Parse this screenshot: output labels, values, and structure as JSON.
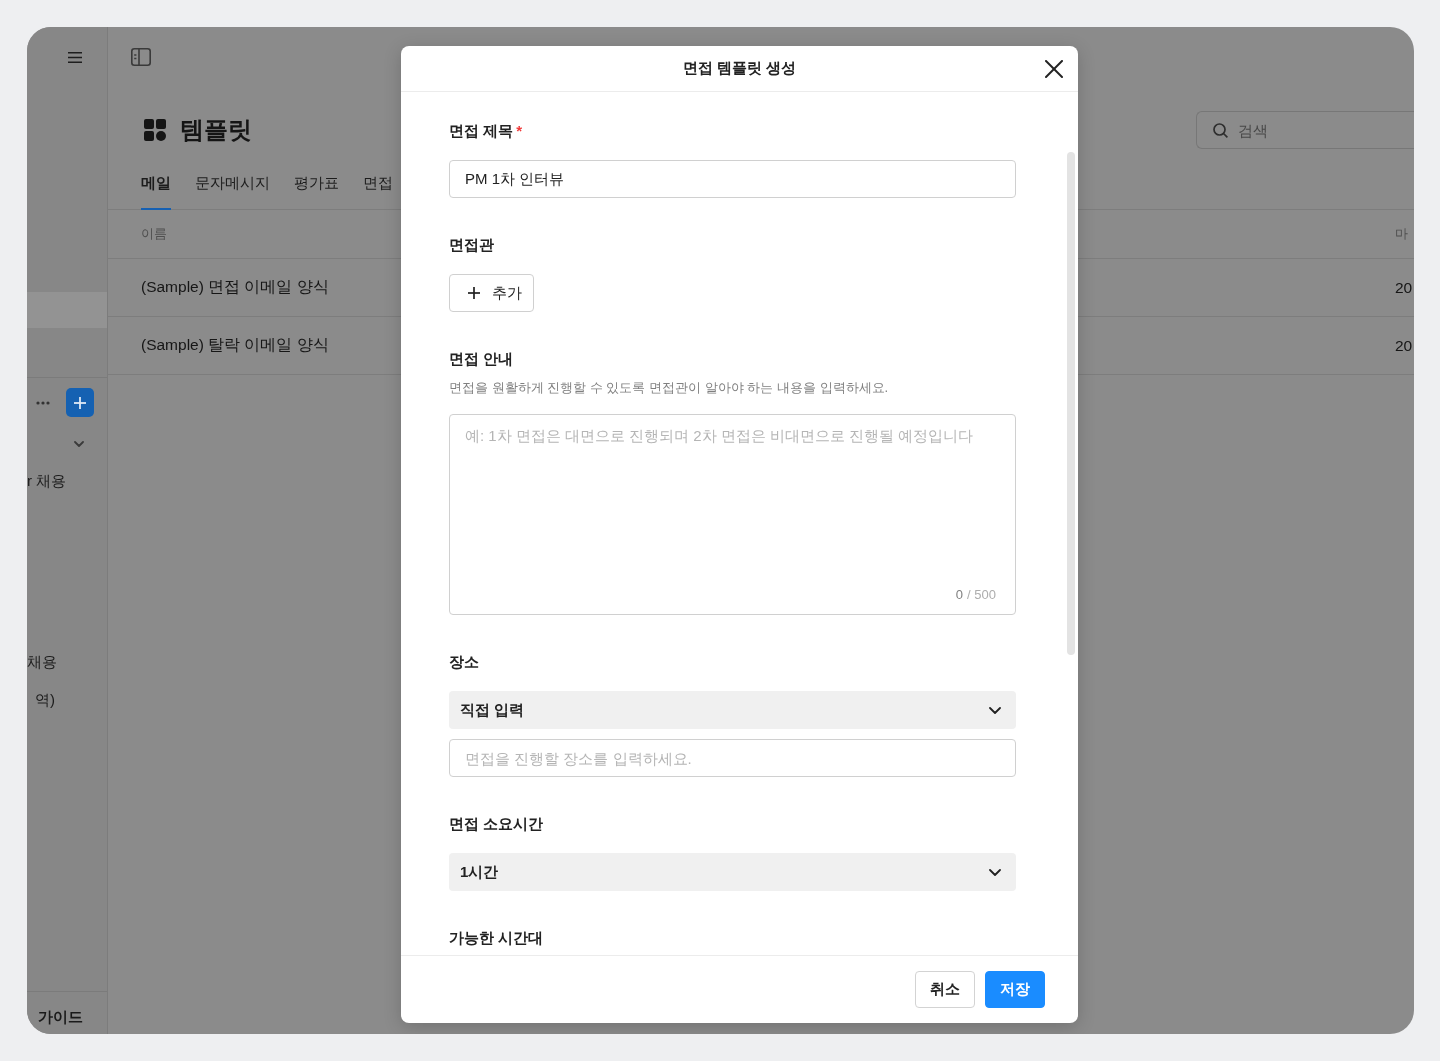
{
  "sidebar": {
    "menu_items": [
      {
        "selected": true
      }
    ],
    "items": [
      {
        "label": "r 채용",
        "selected": false
      },
      {
        "label": "채용",
        "selected": false
      },
      {
        "label": "역)",
        "selected": false
      }
    ],
    "footer_link": "가이드"
  },
  "app": {
    "page_title": "템플릿",
    "tabs": [
      {
        "label": "메일",
        "selected": true
      },
      {
        "label": "문자메시지",
        "selected": false
      },
      {
        "label": "평가표",
        "selected": false
      },
      {
        "label": "면접",
        "selected": false
      }
    ],
    "search": {
      "placeholder": "검색"
    },
    "table": {
      "columns": [
        "이름",
        "마"
      ],
      "rows": [
        [
          "(Sample) 면접 이메일 양식",
          "20"
        ],
        [
          "(Sample) 탈락 이메일 양식",
          "20"
        ]
      ]
    }
  },
  "modal": {
    "title": "면접 템플릿 생성",
    "fields": [
      {
        "kind": "text",
        "label": "면접 제목",
        "required_mark": "*",
        "value": "PM 1차 인터뷰"
      },
      {
        "kind": "add",
        "label": "면접관",
        "button": "추가"
      },
      {
        "kind": "textarea",
        "label": "면접 안내",
        "help": "면접을 원활하게 진행할 수 있도록 면접관이 알아야 하는 내용을 입력하세요.",
        "placeholder": "예: 1차 면접은 대면으로 진행되며 2차 면접은 비대면으로 진행될 예정입니다",
        "count": "0",
        "limit": "/ 500"
      },
      {
        "kind": "select_input",
        "label": "장소",
        "value": "직접 입력",
        "placeholder": "면접을 진행할 장소를 입력하세요."
      },
      {
        "kind": "select",
        "label": "면접 소요시간",
        "value": "1시간"
      },
      {
        "kind": "heading",
        "label": "가능한 시간대"
      }
    ],
    "buttons": [
      {
        "label": "취소",
        "kind": "secondary"
      },
      {
        "label": "저장",
        "kind": "primary"
      }
    ]
  }
}
